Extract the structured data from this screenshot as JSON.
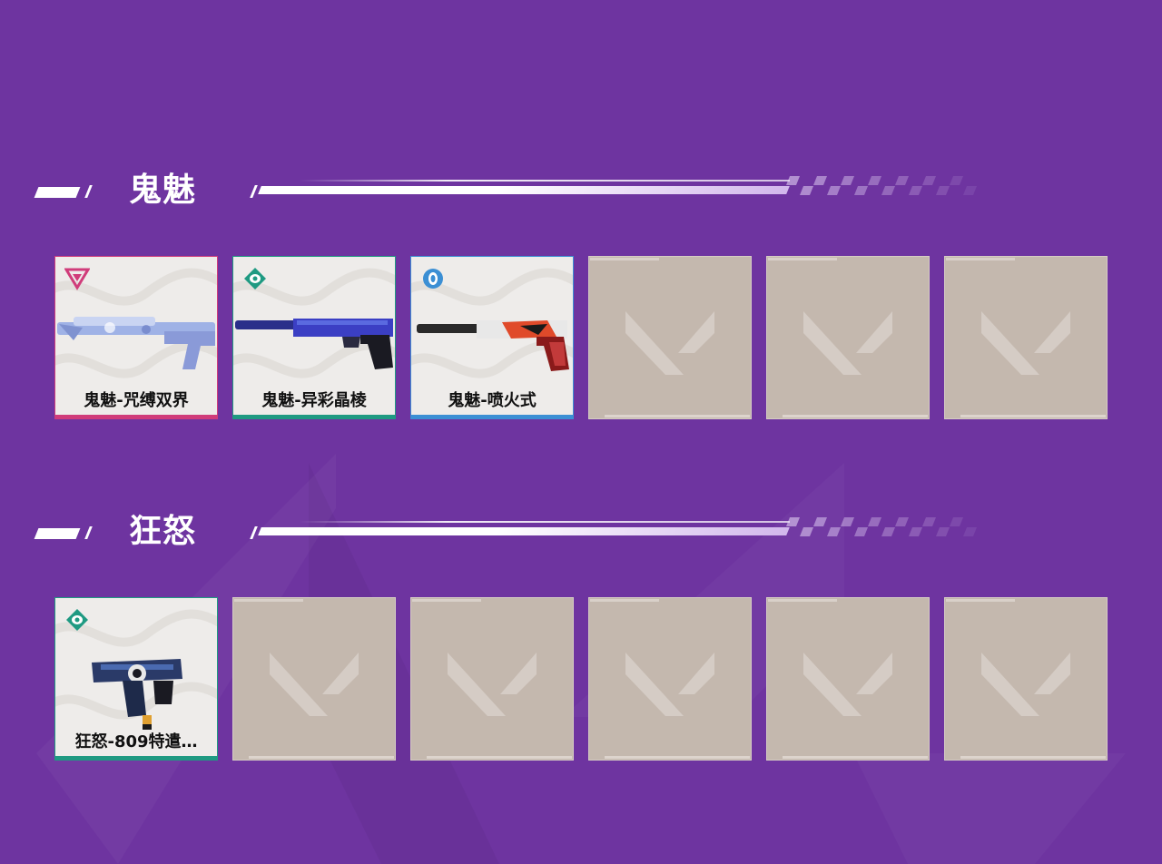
{
  "colors": {
    "background": "#6e34a0",
    "empty_slot": "#c4b8ae",
    "card_bg": "#eeecea",
    "rarity_exclusive": "#d03c7a",
    "rarity_premium": "#1f9a82",
    "rarity_select": "#3b8fd4"
  },
  "sections": [
    {
      "title": "鬼魅",
      "items": [
        {
          "name": "鬼魅-咒缚双界",
          "rarity_icon": "exclusive-triangle-icon",
          "rarity_color": "#d03c7a",
          "gun_icon": "ghost-pistol-icon"
        },
        {
          "name": "鬼魅-异彩晶棱",
          "rarity_icon": "premium-diamond-icon",
          "rarity_color": "#1f9a82",
          "gun_icon": "ghost-pistol-icon"
        },
        {
          "name": "鬼魅-喷火式",
          "rarity_icon": "select-ring-icon",
          "rarity_color": "#3b8fd4",
          "gun_icon": "ghost-pistol-icon"
        }
      ],
      "empty_slots": 3
    },
    {
      "title": "狂怒",
      "items": [
        {
          "name": "狂怒-809特遣…",
          "rarity_icon": "premium-diamond-icon",
          "rarity_color": "#1f9a82",
          "gun_icon": "frenzy-pistol-icon"
        }
      ],
      "empty_slots": 5
    }
  ]
}
